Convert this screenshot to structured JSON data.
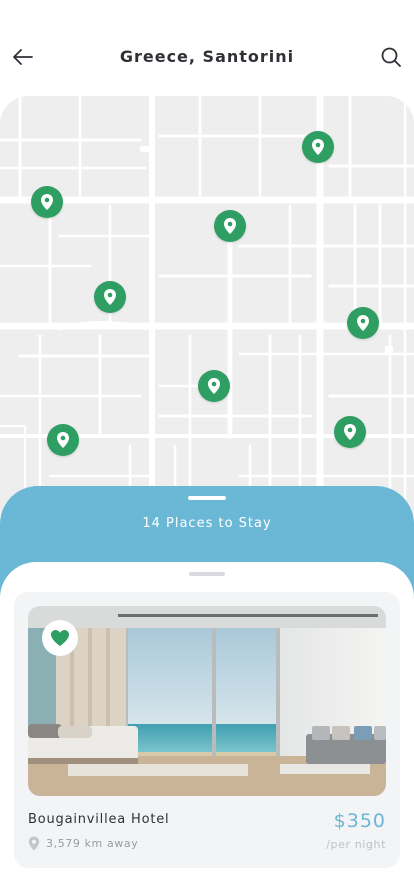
{
  "header": {
    "title": "Greece, Santorini",
    "back_icon": "arrow-left-icon",
    "search_icon": "search-icon"
  },
  "map": {
    "pin_icon": "map-pin-icon",
    "pin_count": 8
  },
  "results": {
    "count_label": "14 Places to Stay"
  },
  "hotel": {
    "name": "Bougainvillea Hotel",
    "distance": "3,579 km away",
    "price": "$350",
    "price_unit": "/per night",
    "favorite": true
  },
  "colors": {
    "accent_green": "#2f9e62",
    "accent_blue": "#6bb7d6",
    "text_dark": "#2f3136",
    "text_muted": "#9a9ca3"
  }
}
